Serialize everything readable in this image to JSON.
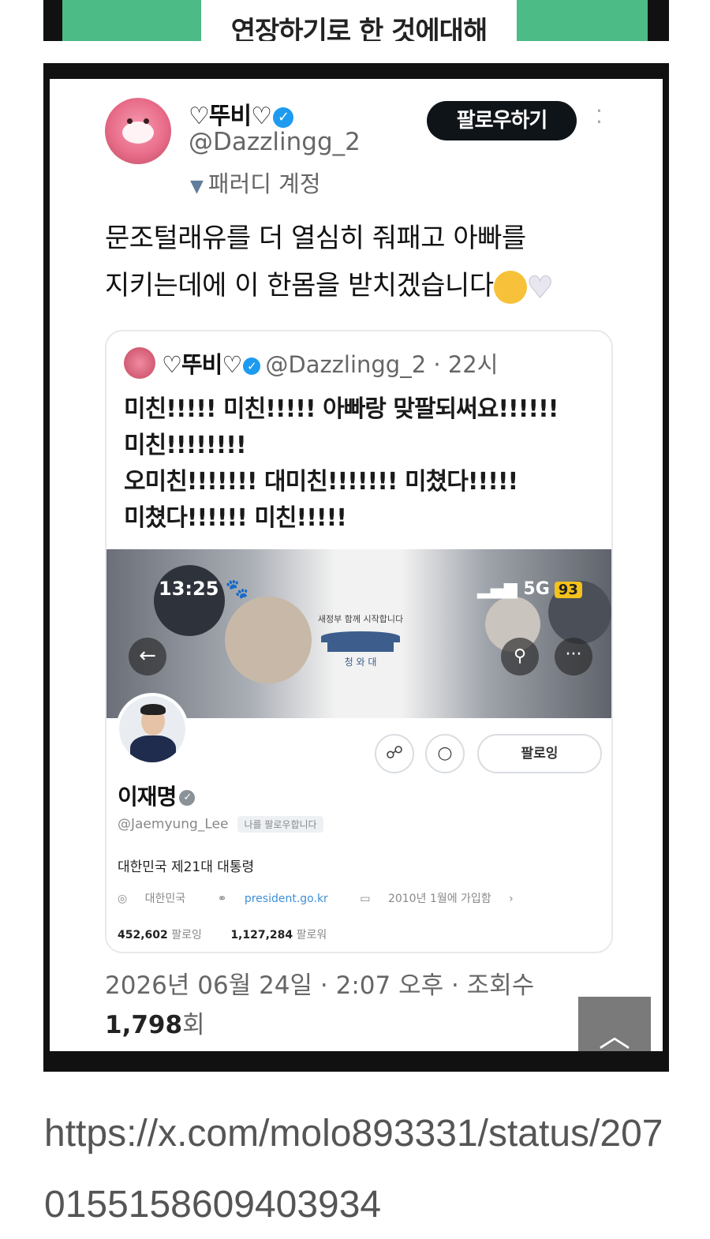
{
  "top_banner": {
    "text": "연장하기로 한 것에대해"
  },
  "tweet": {
    "display_name": "♡뚜비♡",
    "handle": "@Dazzlingg_2",
    "parody_label": "패러디 계정",
    "follow_button": "팔로우하기",
    "text_line1": "문조털래유를 더 열심히 줘패고 아빠를",
    "text_line2": "지키는데에 이 한몸을 받치겠습니다",
    "timestamp": "2026년 06월 24일 · 2:07 오후 · 조회수",
    "views": "1,798",
    "views_suffix": "회"
  },
  "quote": {
    "display_name": "♡뚜비♡",
    "handle_time": "@Dazzlingg_2 · 22시",
    "text": "미친!!!!! 미친!!!!! 아빠랑 맞팔되써요!!!!!!\n미친!!!!!!!!\n오미친!!!!!!! 대미친!!!!!!! 미쳤다!!!!!\n미쳤다!!!!!! 미친!!!!!"
  },
  "embedded_profile": {
    "status_time": "13:25",
    "status_network": "5G",
    "status_battery": "93",
    "banner_text_top": "새정부 함께 시작합니다",
    "banner_text_bottom": "청 와 대",
    "name": "이재명",
    "handle": "@Jaemyung_Lee",
    "follows_you": "나를 팔로우합니다",
    "follow_button": "팔로잉",
    "bio": "대한민국 제21대 대통령",
    "location": "대한민국",
    "website": "president.go.kr",
    "joined": "2010년 1월에 가입함",
    "following_count": "452,602",
    "following_label": "팔로잉",
    "followers_count": "1,127,284",
    "followers_label": "팔로워"
  },
  "url": "https://x.com/molo893331/status/2070155158609403934",
  "colors": {
    "accent_green": "#4cbb85",
    "verified_blue": "#1d9bf0",
    "link_blue": "#3f8fd6"
  }
}
